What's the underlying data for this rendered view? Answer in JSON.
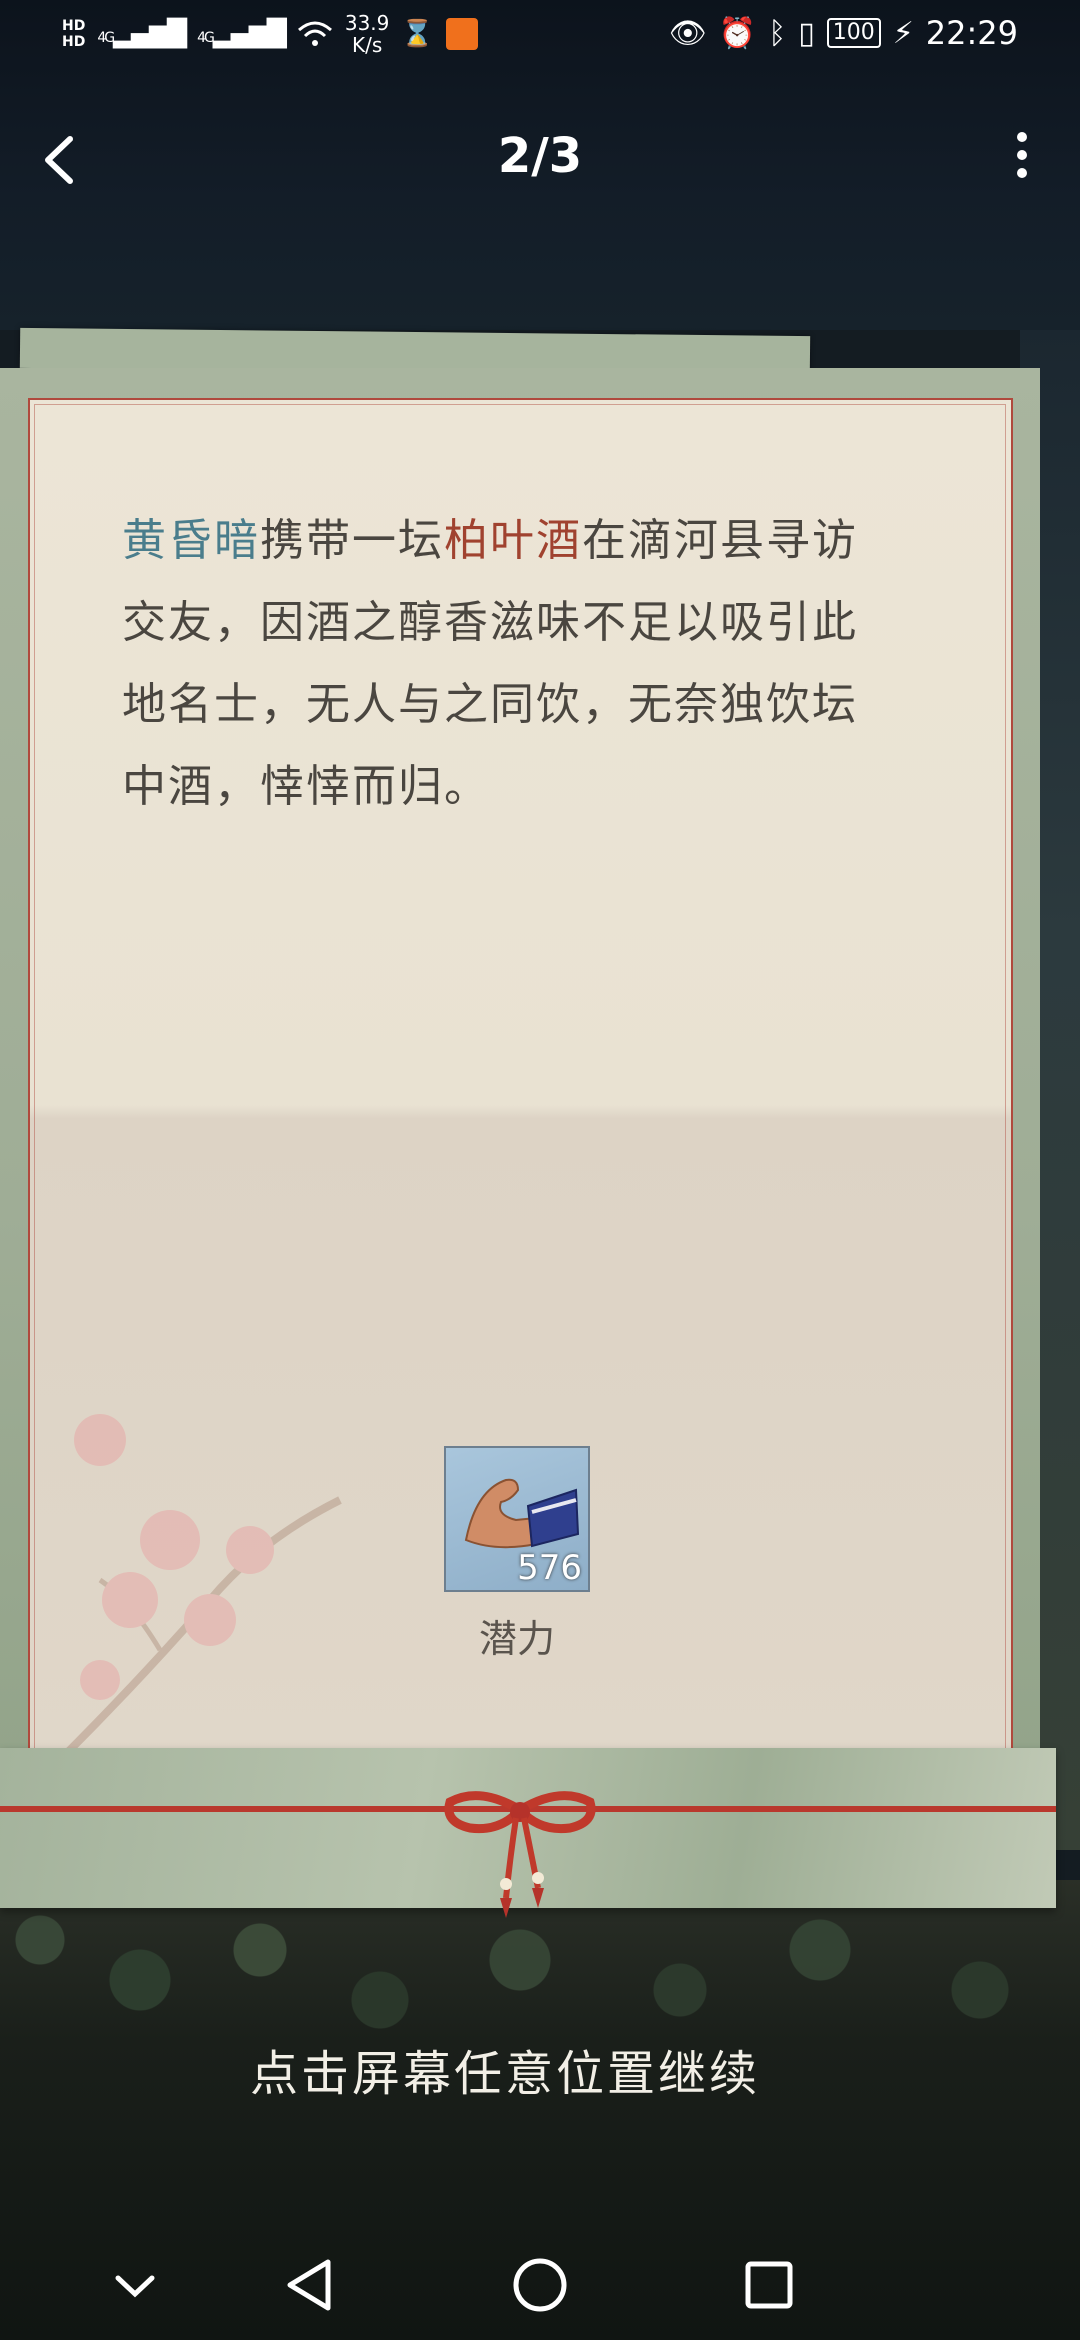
{
  "status_bar": {
    "hd1": "HD",
    "hd2": "HD",
    "network1": "4G",
    "network2": "4G",
    "speed_value": "33.9",
    "speed_unit": "K/s",
    "battery": "100",
    "time": "22:29"
  },
  "header": {
    "back_icon": "chevron-left-icon",
    "title": "2/3",
    "more_icon": "more-vertical-icon"
  },
  "story": {
    "name": "黄昏暗",
    "text1": "携带一坛",
    "item": "柏叶酒",
    "text2": "在滴河县寻访交友，因酒之醇香滋味不足以吸引此地名士，无人与之同饮，无奈独饮坛中酒，悻悻而归。",
    "name_color": "#4a7d8c",
    "item_color": "#a0422f"
  },
  "reward": {
    "icon": "flexed-arm-icon",
    "count": "576",
    "label": "潜力"
  },
  "hint": "点击屏幕任意位置继续",
  "system_nav": {
    "keys": [
      "chevron-down-icon",
      "back-triangle-icon",
      "home-circle-icon",
      "recents-square-icon"
    ]
  }
}
